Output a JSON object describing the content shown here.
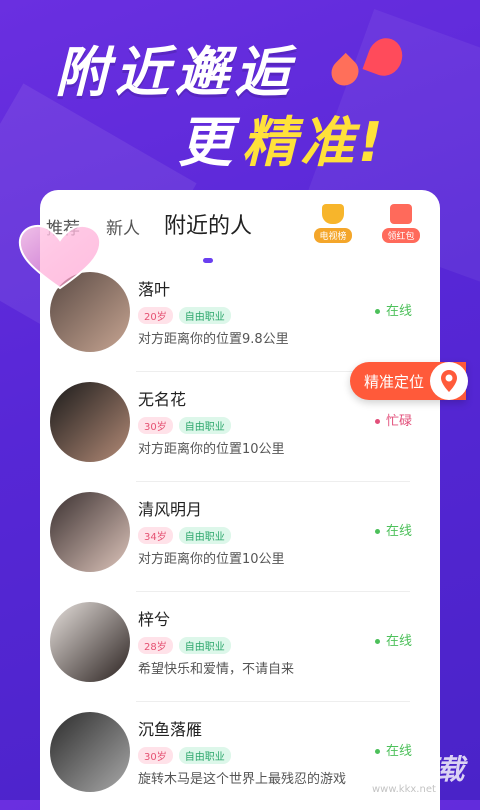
{
  "headline": {
    "line1": "附近邂逅",
    "line2_prefix": "更",
    "line2_accent": "精准!"
  },
  "tabs": [
    {
      "label": "推荐"
    },
    {
      "label": "新人"
    },
    {
      "label": "附近的人"
    }
  ],
  "badges": {
    "tv": {
      "label": "电视榜",
      "icon": "trophy-icon"
    },
    "red": {
      "label": "领红包",
      "icon": "red-envelope-icon"
    }
  },
  "users": [
    {
      "name": "落叶",
      "age": "20岁",
      "job": "自由职业",
      "desc": "对方距离你的位置9.8公里",
      "status": "在线"
    },
    {
      "name": "无名花",
      "age": "30岁",
      "job": "自由职业",
      "desc": "对方距离你的位置10公里",
      "status": "忙碌"
    },
    {
      "name": "清风明月",
      "age": "34岁",
      "job": "自由职业",
      "desc": "对方距离你的位置10公里",
      "status": "在线"
    },
    {
      "name": "梓兮",
      "age": "28岁",
      "job": "自由职业",
      "desc": "希望快乐和爱情，不请自来",
      "status": "在线"
    },
    {
      "name": "沉鱼落雁",
      "age": "30岁",
      "job": "自由职业",
      "desc": "旋转木马是这个世界上最残忍的游戏",
      "status": "在线"
    }
  ],
  "locate_button": {
    "label": "精准定位",
    "icon": "location-pin-icon"
  },
  "watermark": {
    "text": "KK下载",
    "sub": "www.kkx.net"
  },
  "colors": {
    "background": "#5727d6",
    "accent_yellow": "#ffe13a",
    "locate_orange": "#ff5a3a",
    "online_green": "#4cc05a",
    "busy_pink": "#e24f7a"
  }
}
